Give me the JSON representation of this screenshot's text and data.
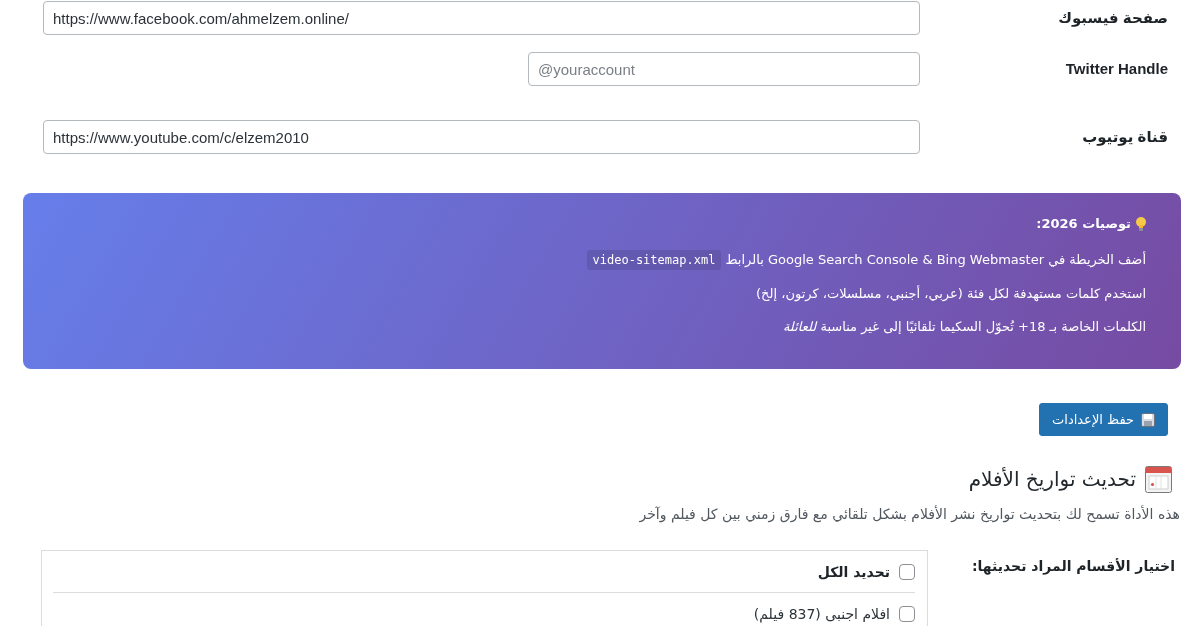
{
  "social_fields": [
    {
      "label": "صفحة فيسبوك",
      "kind": "wide",
      "value": "https://www.facebook.com/ahmelzem.online/"
    },
    {
      "label": "Twitter Handle",
      "kind": "short",
      "placeholder": "@youraccount"
    },
    {
      "label": "قناة يوتيوب",
      "kind": "wide",
      "value": "https://www.youtube.com/c/elzem2010"
    }
  ],
  "tips_box": {
    "title": "توصيات 2026:",
    "lines": [
      {
        "text": "أضف الخريطة في Google Search Console & Bing Webmaster بالرابط",
        "code": "video-sitemap.xml"
      },
      {
        "text": "استخدم كلمات مستهدفة لكل فئة (عربي، أجنبي، مسلسلات، كرتون، إلخ)"
      },
      {
        "text": "الكلمات الخاصة بـ 18+ تُحوّل السكيما تلقائيًا إلى غير مناسبة *للعائلة*"
      }
    ]
  },
  "save_button": {
    "label": "حفظ الإعدادات"
  },
  "date_tool": {
    "heading": "تحديث تواريخ الأفلام",
    "description": "هذه الأداة تسمح لك بتحديث تواريخ نشر الأفلام بشكل تلقائي مع فارق زمني بين كل فيلم وآخر",
    "category_select": {
      "label": "اختيار الأقسام المراد تحديثها:",
      "select_all": {
        "label": "تحديد الكل",
        "checked": false
      },
      "items": [
        {
          "label": "افلام اجنبى (837 فيلم)",
          "checked": false
        }
      ]
    }
  }
}
